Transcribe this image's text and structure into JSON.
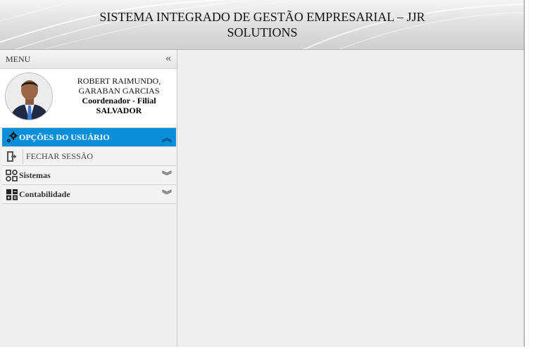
{
  "header": {
    "title_line1": "SISTEMA INTEGRADO DE GESTÃO EMPRESARIAL – JJR",
    "title_line2": "SOLUTIONS"
  },
  "sidebar": {
    "menu_label": "MENU",
    "collapse_icon": "double-chevron-left-icon",
    "user": {
      "name_line1": "ROBERT RAIMUNDO,",
      "name_line2": "GARABAN GARCIAS",
      "role": "Coordenador - Filial",
      "city": "SALVADOR"
    },
    "sections": [
      {
        "label": "OPÇÕES DO USUÁRIO",
        "icon": "gears-icon",
        "expanded": true
      },
      {
        "label": "Sistemas",
        "icon": "modules-icon",
        "expanded": false
      },
      {
        "label": "Contabilidade",
        "icon": "calculator-icon",
        "expanded": false
      }
    ],
    "user_options_items": [
      {
        "label": "FECHAR SESSÃO",
        "icon": "logout-icon"
      }
    ]
  },
  "colors": {
    "active_section": "#0a8fd8",
    "background": "#efefef"
  }
}
